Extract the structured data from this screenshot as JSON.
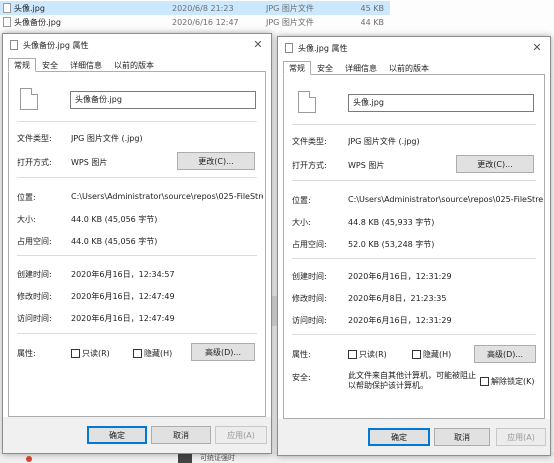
{
  "explorer": {
    "files": [
      {
        "name": "头像.jpg",
        "date": "2020/6/8 21:23",
        "type": "JPG 图片文件",
        "size": "45 KB",
        "selected": true
      },
      {
        "name": "头像备份.jpg",
        "date": "2020/6/16 12:47",
        "type": "JPG 图片文件",
        "size": "44 KB",
        "selected": false
      }
    ],
    "bottom_text": "可统证强时"
  },
  "tabs": [
    "常规",
    "安全",
    "详细信息",
    "以前的版本"
  ],
  "labels": {
    "file_type": "文件类型:",
    "open_with": "打开方式:",
    "location": "位置:",
    "size": "大小:",
    "size_on_disk": "占用空间:",
    "created": "创建时间:",
    "modified": "修改时间:",
    "accessed": "访问时间:",
    "attributes": "属性:",
    "security": "安全:"
  },
  "left_dialog": {
    "title": "头像备份.jpg 属性",
    "filename": "头像备份.jpg",
    "file_type": "JPG 图片文件 (.jpg)",
    "open_with": "WPS 图片",
    "change_button": "更改(C)...",
    "location": "C:\\Users\\Administrator\\source\\repos\\025-FileStre",
    "size": "44.0 KB (45,056 字节)",
    "size_on_disk": "44.0 KB (45,056 字节)",
    "created": "2020年6月16日，12:34:57",
    "modified": "2020年6月16日，12:47:49",
    "accessed": "2020年6月16日，12:47:49",
    "readonly": "只读(R)",
    "hidden": "隐藏(H)",
    "advanced_button": "高级(D)...",
    "ok": "确定",
    "cancel": "取消",
    "apply": "应用(A)"
  },
  "right_dialog": {
    "title": "头像.jpg 属性",
    "filename": "头像.jpg",
    "file_type": "JPG 图片文件 (.jpg)",
    "open_with": "WPS 图片",
    "change_button": "更改(C)...",
    "location": "C:\\Users\\Administrator\\source\\repos\\025-FileStre",
    "size": "44.8 KB (45,933 字节)",
    "size_on_disk": "52.0 KB (53,248 字节)",
    "created": "2020年6月16日，12:31:29",
    "modified": "2020年6月8日，21:23:35",
    "accessed": "2020年6月16日，12:31:29",
    "readonly": "只读(R)",
    "hidden": "隐藏(H)",
    "advanced_button": "高级(D)...",
    "security_text": "此文件来自其他计算机，可能被阻止以帮助保护该计算机。",
    "unblock": "解除锁定(K)",
    "ok": "确定",
    "cancel": "取消",
    "apply": "应用(A)"
  }
}
